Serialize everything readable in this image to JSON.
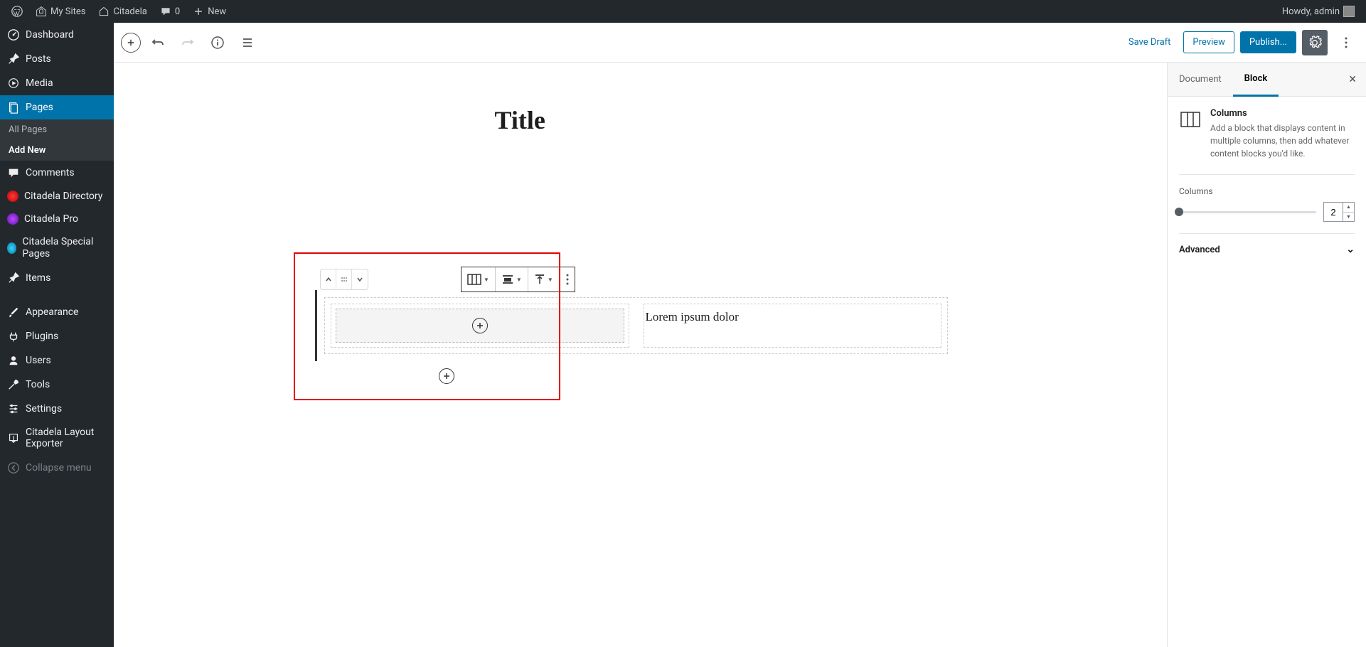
{
  "admin_bar": {
    "my_sites": "My Sites",
    "site_name": "Citadela",
    "comments_count": "0",
    "new": "New",
    "greeting": "Howdy, admin"
  },
  "sidebar": {
    "dashboard": "Dashboard",
    "posts": "Posts",
    "media": "Media",
    "pages": "Pages",
    "all_pages": "All Pages",
    "add_new": "Add New",
    "comments": "Comments",
    "citadela_dir": "Citadela Directory",
    "citadela_pro": "Citadela Pro",
    "citadela_special": "Citadela Special Pages",
    "items": "Items",
    "appearance": "Appearance",
    "plugins": "Plugins",
    "users": "Users",
    "tools": "Tools",
    "settings": "Settings",
    "layout_exporter": "Citadela Layout Exporter",
    "collapse": "Collapse menu"
  },
  "editor": {
    "save_draft": "Save Draft",
    "preview": "Preview",
    "publish": "Publish...",
    "title": "Title",
    "column_text": "Lorem ipsum dolor"
  },
  "inspector": {
    "tab_document": "Document",
    "tab_block": "Block",
    "block_name": "Columns",
    "block_desc": "Add a block that displays content in multiple columns, then add whatever content blocks you'd like.",
    "columns_label": "Columns",
    "columns_value": "2",
    "advanced": "Advanced"
  }
}
